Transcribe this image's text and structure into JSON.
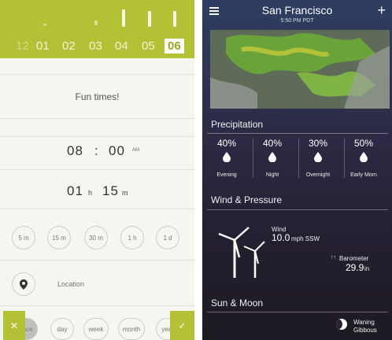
{
  "left": {
    "hour_numbers": [
      "01",
      "02",
      "03",
      "04",
      "05",
      "06"
    ],
    "selected_hour": "06",
    "faded_left": "12",
    "title": "Fun times!",
    "time": {
      "hour": "08",
      "minute": "00",
      "ampm": "AM"
    },
    "duration": {
      "hours": "01",
      "hours_unit": "h",
      "minutes": "15",
      "minutes_unit": "m"
    },
    "quick_durations": [
      "5 m",
      "15 m",
      "30 m",
      "1 h",
      "1 d"
    ],
    "location_label": "Location",
    "repeat_options": [
      "once",
      "day",
      "week",
      "month",
      "year"
    ]
  },
  "right": {
    "city": "San Francisco",
    "time": "5:50 PM PDT",
    "precipitation": {
      "title": "Precipitation",
      "items": [
        {
          "pct": "40%",
          "label": "Evening"
        },
        {
          "pct": "40%",
          "label": "Night"
        },
        {
          "pct": "30%",
          "label": "Overnight"
        },
        {
          "pct": "50%",
          "label": "Early Morn"
        }
      ]
    },
    "wind": {
      "title": "Wind & Pressure",
      "wind_label": "Wind",
      "wind_value": "10.0",
      "wind_unit": "mph SSW",
      "baro_label": "Barometer",
      "baro_value": "29.9",
      "baro_unit": "in"
    },
    "sun": {
      "title": "Sun & Moon",
      "moon_phase_1": "Waning",
      "moon_phase_2": "Gibbous"
    }
  },
  "colors": {
    "accent": "#b3c234",
    "dark_bg": "#2c2a45"
  }
}
